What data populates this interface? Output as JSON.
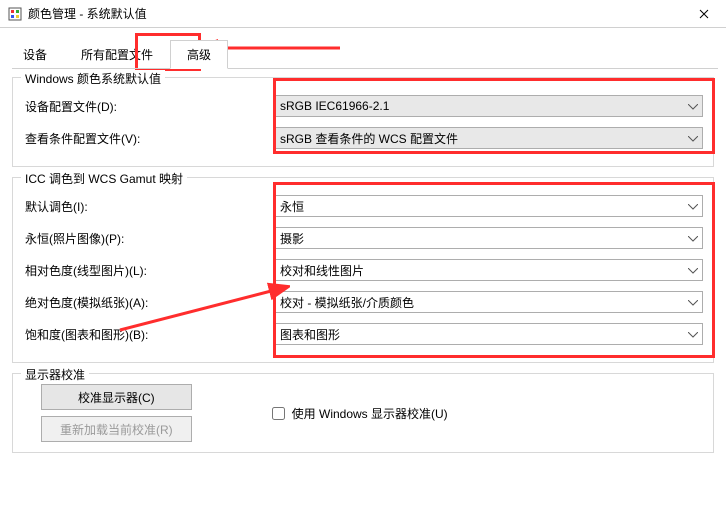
{
  "window": {
    "title": "颜色管理 - 系统默认值"
  },
  "tabs": {
    "device": "设备",
    "profiles": "所有配置文件",
    "advanced": "高级"
  },
  "group_defaults": {
    "legend": "Windows 颜色系统默认值",
    "device_profile_label": "设备配置文件(D):",
    "device_profile_value": "sRGB IEC61966-2.1",
    "view_cond_label": "查看条件配置文件(V):",
    "view_cond_value": "sRGB 查看条件的 WCS 配置文件"
  },
  "group_icc": {
    "legend": "ICC 调色到 WCS Gamut 映射",
    "rows": [
      {
        "label": "默认调色(I):",
        "value": "永恒"
      },
      {
        "label": "永恒(照片图像)(P):",
        "value": "摄影"
      },
      {
        "label": "相对色度(线型图片)(L):",
        "value": "校对和线性图片"
      },
      {
        "label": "绝对色度(模拟纸张)(A):",
        "value": "校对 - 模拟纸张/介质颜色"
      },
      {
        "label": "饱和度(图表和图形)(B):",
        "value": "图表和图形"
      }
    ]
  },
  "group_calib": {
    "legend": "显示器校准",
    "btn_calibrate": "校准显示器(C)",
    "btn_reload": "重新加载当前校准(R)",
    "checkbox_label": "使用 Windows 显示器校准(U)"
  }
}
